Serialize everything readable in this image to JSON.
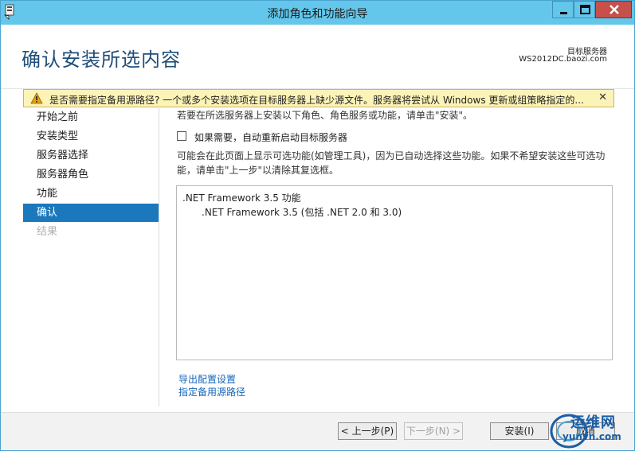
{
  "window": {
    "title": "添加角色和功能向导"
  },
  "header": {
    "page_title": "确认安装所选内容",
    "destination_label": "目标服务器",
    "destination_value": "WS2012DC.baozi.com"
  },
  "warning": {
    "text": "是否需要指定备用源路径? 一个或多个安装选项在目标服务器上缺少源文件。服务器将尝试从 Windows 更新或组策略指定的...",
    "close_label": "✕"
  },
  "nav": {
    "items": [
      {
        "label": "开始之前",
        "state": "normal"
      },
      {
        "label": "安装类型",
        "state": "normal"
      },
      {
        "label": "服务器选择",
        "state": "normal"
      },
      {
        "label": "服务器角色",
        "state": "normal"
      },
      {
        "label": "功能",
        "state": "normal"
      },
      {
        "label": "确认",
        "state": "active"
      },
      {
        "label": "结果",
        "state": "disabled"
      }
    ]
  },
  "content": {
    "intro": "若要在所选服务器上安装以下角色、角色服务或功能，请单击\"安装\"。",
    "restart_checkbox_label": "如果需要，自动重新启动目标服务器",
    "restart_checked": false,
    "optional_note_line1": "可能会在此页面上显示可选功能(如管理工具)，因为已自动选择这些功能。如果不希望安装这些可选功",
    "optional_note_line2": "能，请单击\"上一步\"以清除其复选框。",
    "features": {
      "name": ".NET Framework 3.5 功能",
      "sub": ".NET Framework 3.5 (包括 .NET 2.0 和 3.0)"
    },
    "link_export": "导出配置设置",
    "link_alt_source": "指定备用源路径"
  },
  "footer": {
    "prev_label": "< 上一步(P)",
    "next_label": "下一步(N) >",
    "install_label": "安装(I)",
    "cancel_label": "取消"
  },
  "watermark": {
    "cn": "运维网",
    "en": "yunvn.com"
  },
  "colors": {
    "titlebar": "#63c6ea",
    "accent": "#1b78bd",
    "page_title": "#1f4e79",
    "warning_bg": "#fcf3b7",
    "link": "#1667b8",
    "close_button": "#c7504a"
  }
}
